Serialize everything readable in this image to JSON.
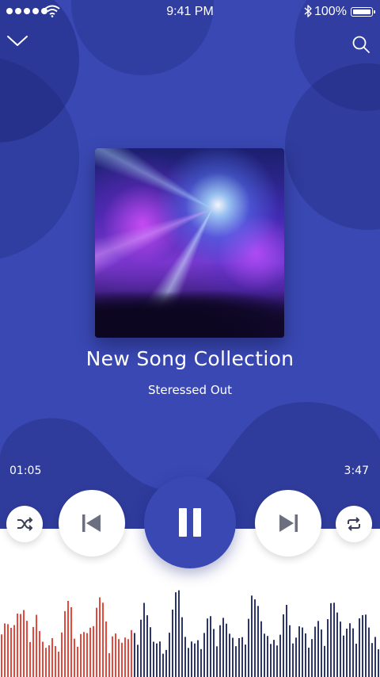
{
  "status_bar": {
    "time": "9:41 PM",
    "battery_text": "100%",
    "signal_icon": "signal-dots-icon",
    "wifi_icon": "wifi-icon",
    "bluetooth_icon": "bluetooth-icon",
    "battery_icon": "battery-icon"
  },
  "header": {
    "collapse_icon": "chevron-down-icon",
    "search_icon": "search-icon"
  },
  "now_playing": {
    "title": "New Song Collection",
    "artist": "Steressed Out",
    "album_art": "concert-stage-lights-image"
  },
  "progress": {
    "elapsed": "01:05",
    "duration": "3:47",
    "played_fraction": 0.35
  },
  "controls": {
    "shuffle_icon": "shuffle-icon",
    "previous_icon": "previous-track-icon",
    "play_state_icon": "pause-icon",
    "next_icon": "next-track-icon",
    "repeat_icon": "repeat-icon"
  },
  "colors": {
    "accent": "#3a48b4",
    "played_wave": "#e8473c",
    "unplayed_wave": "#2c3470",
    "background": "#ffffff"
  }
}
